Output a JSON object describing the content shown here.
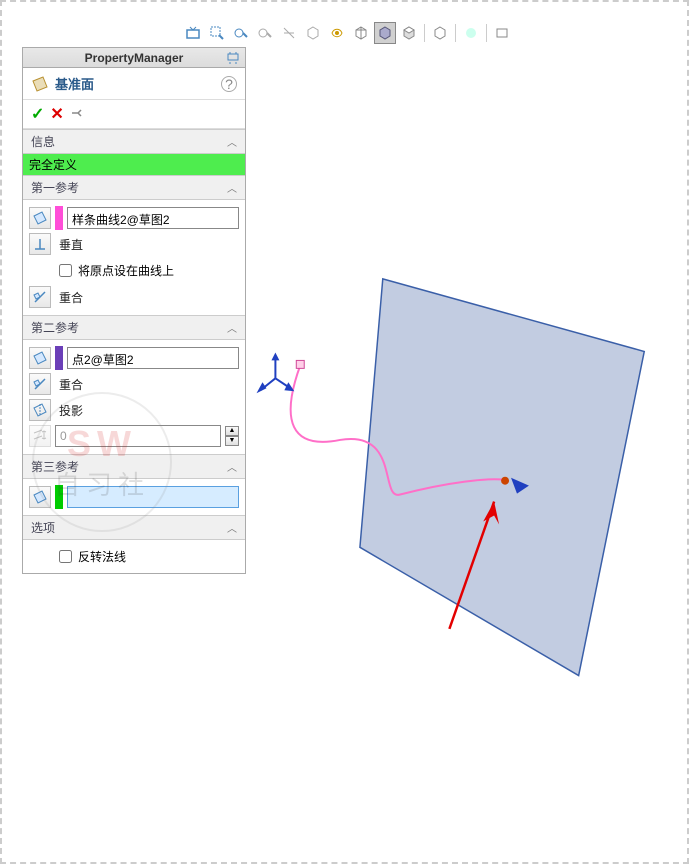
{
  "panel": {
    "title": "PropertyManager",
    "feature_name": "基准面"
  },
  "info": {
    "header": "信息",
    "status": "完全定义"
  },
  "ref1": {
    "header": "第一参考",
    "entity": "样条曲线2@草图2",
    "perpendicular": "垂直",
    "origin_on_curve": "将原点设在曲线上",
    "coincident": "重合"
  },
  "ref2": {
    "header": "第二参考",
    "entity": "点2@草图2",
    "coincident": "重合",
    "project": "投影",
    "distance": "0"
  },
  "ref3": {
    "header": "第三参考",
    "entity": ""
  },
  "options": {
    "header": "选项",
    "flip_normal": "反转法线"
  },
  "watermark": {
    "top": "SW",
    "bottom": "自习社"
  }
}
